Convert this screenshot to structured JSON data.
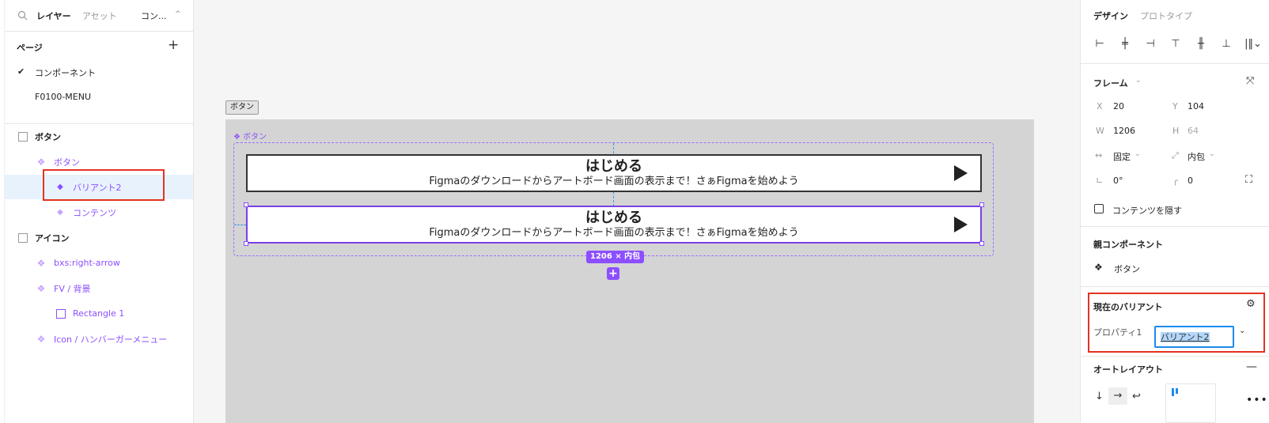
{
  "left_panel": {
    "tabs": {
      "layers": "レイヤー",
      "assets": "アセット",
      "page": "コン..."
    },
    "pages_header": "ページ",
    "pages": [
      "コンポーネント",
      "F0100-MENU"
    ],
    "layers": {
      "frame_button": "ボタン",
      "component_set": "ボタン",
      "variant2": "バリアント2",
      "contents": "コンテンツ",
      "frame_icon": "アイコン",
      "right_arrow": "bxs:right-arrow",
      "fv_bg": "FV / 背景",
      "rect1": "Rectangle 1",
      "hamburger": "Icon / ハンバーガーメニュー"
    }
  },
  "canvas": {
    "frame_tag": "ボタン",
    "set_label": "❖ ボタン",
    "button_title": "はじめる",
    "button_subtitle": "Figmaのダウンロードからアートボード画面の表示まで！さぁFigmaを始めよう",
    "size_badge": "1206 × 内包",
    "plus": "+"
  },
  "right_panel": {
    "tabs": {
      "design": "デザイン",
      "prototype": "プロトタイプ"
    },
    "frame_section": "フレーム",
    "x_label": "X",
    "x_value": "20",
    "y_label": "Y",
    "y_value": "104",
    "w_label": "W",
    "w_value": "1206",
    "h_label": "H",
    "h_value": "64",
    "width_mode": "固定",
    "height_mode": "内包",
    "rotation": "0°",
    "radius": "0",
    "clip_content": "コンテンツを隠す",
    "parent_component_section": "親コンポーネント",
    "parent_component": "ボタン",
    "current_variant_section": "現在のバリアント",
    "property_label": "プロパティ1",
    "property_value": "バリアント2",
    "autolayout_section": "オートレイアウト"
  },
  "colors": {
    "accent": "#8c4fff",
    "highlight": "#e53222",
    "selection": "#1b8bf0"
  }
}
